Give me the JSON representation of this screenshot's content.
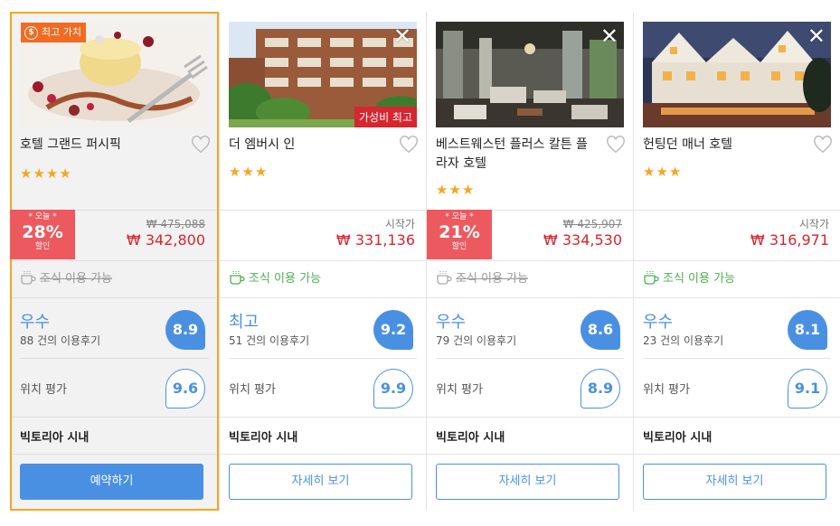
{
  "hotels": [
    {
      "name": "호텔 그랜드 퍼시픽",
      "badge": "최고 가치",
      "stars": "★★★★",
      "discount": {
        "today": "* 오늘 *",
        "percent": "28%",
        "off": "할인"
      },
      "old_price": "₩ 475,088",
      "price": "₩ 342,800",
      "breakfast": "조식 이용 가능",
      "rating_word": "우수",
      "reviews": "88 건의 이용후기",
      "score": "8.9",
      "location_label": "위치 평가",
      "location_score": "9.6",
      "area": "빅토리아 시내",
      "button": "예약하기"
    },
    {
      "name": "더 엠버시 인",
      "badge": "가성비 최고",
      "stars": "★★★",
      "from_label": "시작가",
      "price": "₩ 331,136",
      "breakfast": "조식 이용 가능",
      "rating_word": "최고",
      "reviews": "51 건의 이용후기",
      "score": "9.2",
      "location_label": "위치 평가",
      "location_score": "9.9",
      "area": "빅토리아 시내",
      "button": "자세히 보기"
    },
    {
      "name": "베스트웨스턴 플러스 칼튼 플라자 호텔",
      "stars": "★★★",
      "discount": {
        "today": "* 오늘 *",
        "percent": "21%",
        "off": "할인"
      },
      "old_price": "₩ 425,907",
      "price": "₩ 334,530",
      "breakfast": "조식 이용 가능",
      "rating_word": "우수",
      "reviews": "79 건의 이용후기",
      "score": "8.6",
      "location_label": "위치 평가",
      "location_score": "8.9",
      "area": "빅토리아 시내",
      "button": "자세히 보기"
    },
    {
      "name": "헌팅던 매너 호텔",
      "stars": "★★★",
      "from_label": "시작가",
      "price": "₩ 316,971",
      "breakfast": "조식 이용 가능",
      "rating_word": "우수",
      "reviews": "23 건의 이용후기",
      "score": "8.1",
      "location_label": "위치 평가",
      "location_score": "9.1",
      "area": "빅토리아 시내",
      "button": "자세히 보기"
    }
  ],
  "icons": {
    "close": "close-icon",
    "heart": "heart-icon",
    "coffee": "coffee-cup-icon",
    "badge": "value-badge-icon"
  },
  "colors": {
    "accent_blue": "#4a90e2",
    "price_red": "#d6262f",
    "discount_red": "#ec5a5f",
    "badge_orange": "#f26b21",
    "highlight_border": "#f5a623",
    "star": "#f5a623",
    "breakfast_green": "#4caf50"
  }
}
